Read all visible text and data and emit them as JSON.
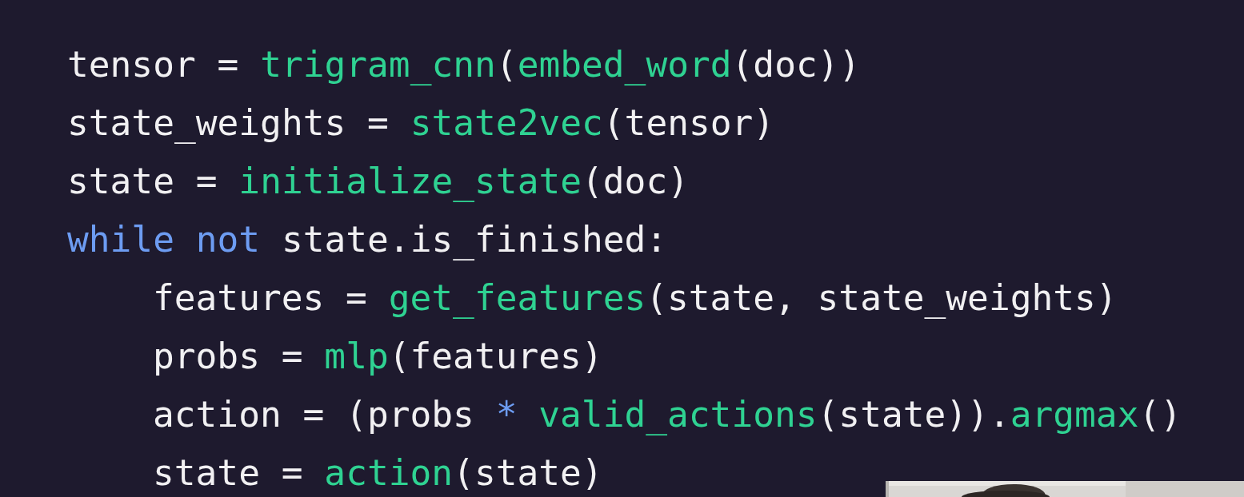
{
  "code_lines": [
    {
      "tokens": [
        {
          "kind": "plain",
          "text": "tensor = "
        },
        {
          "kind": "function",
          "text": "trigram_cnn"
        },
        {
          "kind": "plain",
          "text": "("
        },
        {
          "kind": "function",
          "text": "embed_word"
        },
        {
          "kind": "plain",
          "text": "(doc))"
        }
      ]
    },
    {
      "tokens": [
        {
          "kind": "plain",
          "text": "state_weights = "
        },
        {
          "kind": "function",
          "text": "state2vec"
        },
        {
          "kind": "plain",
          "text": "(tensor)"
        }
      ]
    },
    {
      "tokens": [
        {
          "kind": "plain",
          "text": "state = "
        },
        {
          "kind": "function",
          "text": "initialize_state"
        },
        {
          "kind": "plain",
          "text": "(doc)"
        }
      ]
    },
    {
      "tokens": [
        {
          "kind": "keyword",
          "text": "while not"
        },
        {
          "kind": "plain",
          "text": " state.is_finished:"
        }
      ],
      "children": [
        {
          "tokens": [
            {
              "kind": "plain",
              "text": "features = "
            },
            {
              "kind": "function",
              "text": "get_features"
            },
            {
              "kind": "plain",
              "text": "(state, state_weights)"
            }
          ]
        },
        {
          "tokens": [
            {
              "kind": "plain",
              "text": "probs = "
            },
            {
              "kind": "function",
              "text": "mlp"
            },
            {
              "kind": "plain",
              "text": "(features)"
            }
          ]
        },
        {
          "tokens": [
            {
              "kind": "plain",
              "text": "action = (probs "
            },
            {
              "kind": "keyword",
              "text": "* "
            },
            {
              "kind": "function",
              "text": "valid_actions"
            },
            {
              "kind": "plain",
              "text": "(state))."
            },
            {
              "kind": "function",
              "text": "argmax"
            },
            {
              "kind": "plain",
              "text": "()"
            }
          ]
        },
        {
          "tokens": [
            {
              "kind": "plain",
              "text": "state = "
            },
            {
              "kind": "function",
              "text": "action"
            },
            {
              "kind": "plain",
              "text": "(state)"
            }
          ]
        }
      ]
    }
  ]
}
